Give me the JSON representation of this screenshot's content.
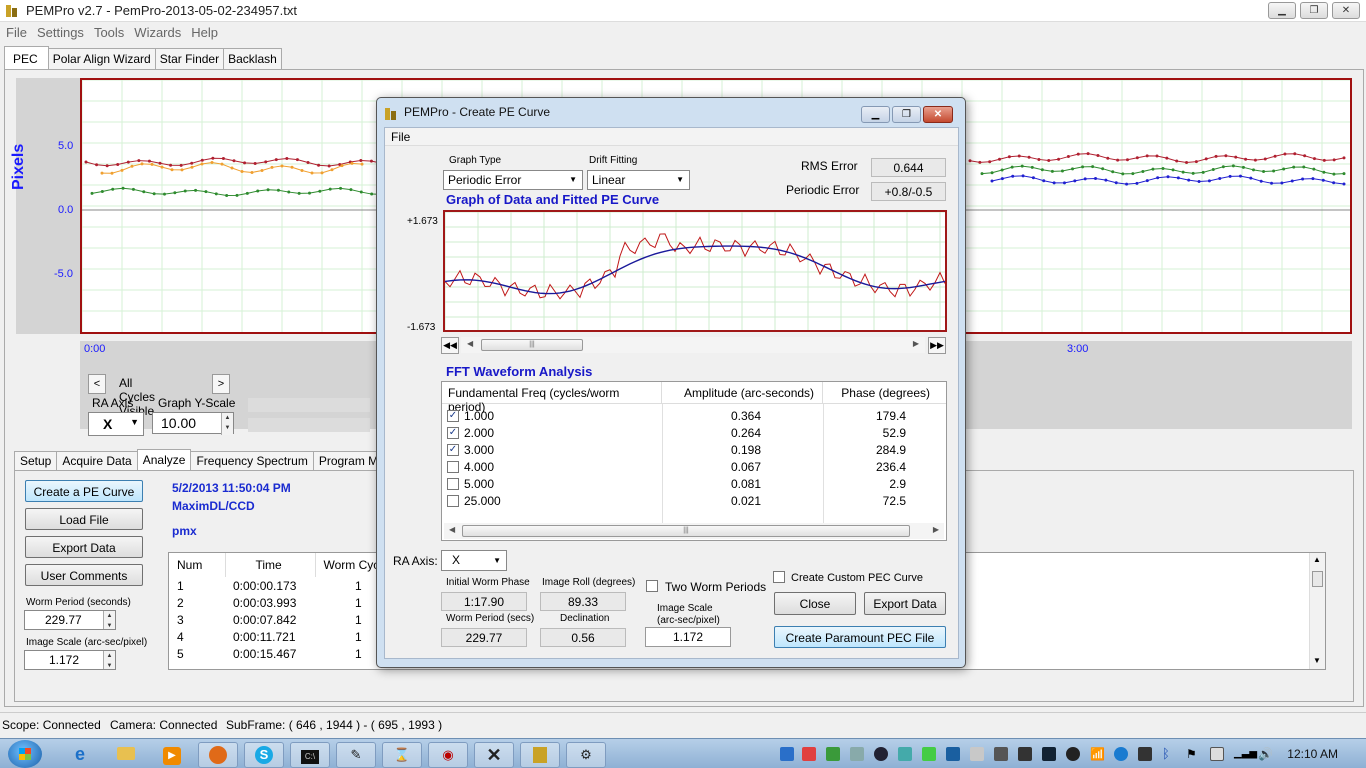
{
  "window": {
    "title": "PEMPro v2.7 - PemPro-2013-05-02-234957.txt"
  },
  "menu": [
    "File",
    "Settings",
    "Tools",
    "Wizards",
    "Help"
  ],
  "main_tabs": [
    "PEC",
    "Polar Align Wizard",
    "Star Finder",
    "Backlash"
  ],
  "plot": {
    "ylabel": "Pixels",
    "yticks": [
      "5.0",
      "0.0",
      "-5.0"
    ],
    "time_ticks": [
      "0:00",
      "3:00"
    ],
    "colors": {
      "red": "#b02030",
      "orange": "#f0a030",
      "green": "#2e8b2e",
      "blue": "#2020d0"
    }
  },
  "cycles": {
    "label": "All Cycles Visible",
    "prev": "<",
    "next": ">"
  },
  "ra_axis": {
    "label": "RA Axis",
    "value": "X"
  },
  "y_scale": {
    "label": "Graph Y-Scale",
    "value": "10.00"
  },
  "sub_tabs": [
    "Setup",
    "Acquire Data",
    "Analyze",
    "Frequency Spectrum",
    "Program Mount"
  ],
  "buttons": {
    "create_pe": "Create a PE Curve",
    "load_file": "Load File",
    "export_data": "Export Data",
    "user_comments": "User Comments"
  },
  "worm_period": {
    "label": "Worm Period (seconds)",
    "value": "229.77"
  },
  "image_scale": {
    "label": "Image Scale (arc-sec/pixel)",
    "value": "1.172"
  },
  "info": {
    "date": "5/2/2013 11:50:04 PM",
    "source": "MaximDL/CCD",
    "note": "pmx"
  },
  "data_table": {
    "headers": [
      "Num",
      "Time",
      "Worm Cycle"
    ],
    "rows": [
      [
        "1",
        "0:00:00.173",
        "1"
      ],
      [
        "2",
        "0:00:03.993",
        "1"
      ],
      [
        "3",
        "0:00:07.842",
        "1"
      ],
      [
        "4",
        "0:00:11.721",
        "1"
      ],
      [
        "5",
        "0:00:15.467",
        "1"
      ]
    ]
  },
  "status": {
    "scope": "Scope: Connected",
    "camera": "Camera: Connected",
    "subframe": "SubFrame: ( 646 , 1944 ) - ( 695 , 1993 )"
  },
  "taskbar": {
    "clock": "12:10 AM"
  },
  "dialog": {
    "title": "PEMPro - Create PE Curve",
    "menu": "File",
    "graph_type": {
      "label": "Graph Type",
      "value": "Periodic Error"
    },
    "drift_fitting": {
      "label": "Drift Fitting",
      "value": "Linear"
    },
    "rms_error": {
      "label": "RMS Error",
      "value": "0.644"
    },
    "periodic_error": {
      "label": "Periodic Error",
      "value": "+0.8/-0.5"
    },
    "graph_title": "Graph of Data and Fitted PE Curve",
    "y_max": "+1.673",
    "y_min": "-1.673",
    "fft_title": "FFT Waveform Analysis",
    "fft_headers": [
      "Fundamental Freq (cycles/worm period)",
      "Amplitude (arc-seconds)",
      "Phase (degrees)"
    ],
    "fft_rows": [
      {
        "checked": true,
        "freq": "1.000",
        "amp": "0.364",
        "phase": "179.4"
      },
      {
        "checked": true,
        "freq": "2.000",
        "amp": "0.264",
        "phase": "52.9"
      },
      {
        "checked": true,
        "freq": "3.000",
        "amp": "0.198",
        "phase": "284.9"
      },
      {
        "checked": false,
        "freq": "4.000",
        "amp": "0.067",
        "phase": "236.4"
      },
      {
        "checked": false,
        "freq": "5.000",
        "amp": "0.081",
        "phase": "2.9"
      },
      {
        "checked": false,
        "freq": "25.000",
        "amp": "0.021",
        "phase": "72.5"
      }
    ],
    "ra_axis": {
      "label": "RA Axis:",
      "value": "X"
    },
    "initial_worm_phase": {
      "label": "Initial Worm Phase",
      "value": "1:17.90"
    },
    "image_roll": {
      "label": "Image Roll (degrees)",
      "value": "89.33"
    },
    "worm_period": {
      "label": "Worm Period (secs)",
      "value": "229.77"
    },
    "declination": {
      "label": "Declination",
      "value": "0.56"
    },
    "two_worm": "Two Worm Periods",
    "image_scale": {
      "label1": "Image Scale",
      "label2": "(arc-sec/pixel)",
      "value": "1.172"
    },
    "custom_pec": "Create Custom PEC Curve",
    "close": "Close",
    "export": "Export Data",
    "create_paramount": "Create Paramount PEC File"
  }
}
